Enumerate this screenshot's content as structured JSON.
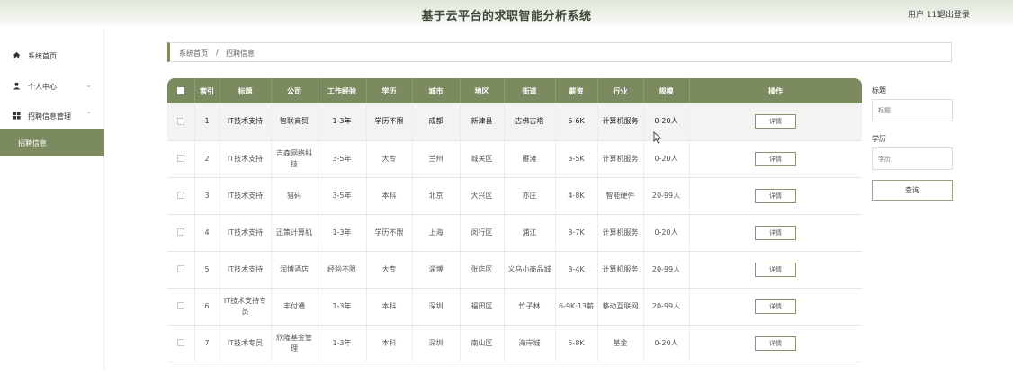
{
  "header": {
    "title": "基于云平台的求职智能分析系统",
    "user": "用户 111",
    "logout": "退出登录"
  },
  "sidebar": {
    "items": [
      {
        "label": "系统首页",
        "icon": "home-icon"
      },
      {
        "label": "个人中心",
        "icon": "person-icon"
      },
      {
        "label": "招聘信息管理",
        "icon": "grid-icon"
      }
    ],
    "sub_item": "招聘信息"
  },
  "breadcrumb": {
    "home": "系统首页",
    "sep": "/",
    "current": "招聘信息"
  },
  "table": {
    "columns": [
      "索引",
      "标题",
      "公司",
      "工作经验",
      "学历",
      "城市",
      "地区",
      "街道",
      "薪资",
      "行业",
      "规模",
      "操作"
    ],
    "rows": [
      [
        "1",
        "IT技术支持",
        "智联商贸",
        "1-3年",
        "学历不限",
        "成都",
        "新津县",
        "古佛古塔",
        "5-6K",
        "计算机服务",
        "0-20人"
      ],
      [
        "2",
        "IT技术支持",
        "吉森网络科技",
        "3-5年",
        "大专",
        "兰州",
        "城关区",
        "雁滩",
        "3-5K",
        "计算机服务",
        "0-20人"
      ],
      [
        "3",
        "IT技术支持",
        "猎码",
        "3-5年",
        "本科",
        "北京",
        "大兴区",
        "亦庄",
        "4-8K",
        "智能硬件",
        "20-99人"
      ],
      [
        "4",
        "IT技术支持",
        "迅策计算机",
        "1-3年",
        "学历不限",
        "上海",
        "闵行区",
        "浦江",
        "3-7K",
        "计算机服务",
        "0-20人"
      ],
      [
        "5",
        "IT技术支持",
        "润博酒店",
        "经验不限",
        "大专",
        "淄博",
        "张店区",
        "义乌小商品城",
        "3-4K",
        "计算机服务",
        "20-99人"
      ],
      [
        "6",
        "IT技术支持专员",
        "丰付通",
        "1-3年",
        "本科",
        "深圳",
        "福田区",
        "竹子林",
        "6-9K·13薪",
        "移动互联网",
        "20-99人"
      ],
      [
        "7",
        "IT技术专员",
        "欣隆基金管理",
        "1-3年",
        "本科",
        "深圳",
        "南山区",
        "海岸城",
        "5-8K",
        "基金",
        "0-20人"
      ]
    ],
    "action_label": "详情"
  },
  "filters": {
    "title_label": "标题",
    "title_placeholder": "标题",
    "edu_label": "学历",
    "edu_placeholder": "学历",
    "query_button": "查询"
  },
  "colors": {
    "accent": "#7b8b5f",
    "header_bg": "#dfe6d6"
  }
}
